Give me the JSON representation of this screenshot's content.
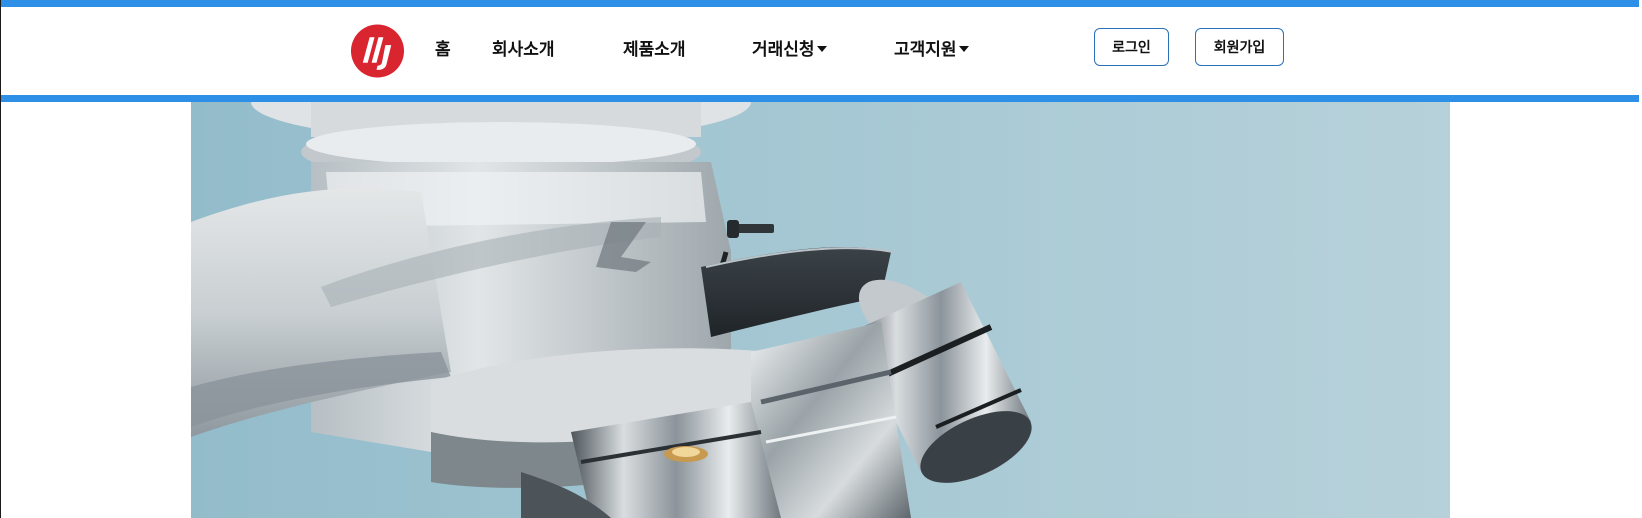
{
  "brand": {
    "logo_icon": "company-logo-icon",
    "logo_color": "#d9252f",
    "accent_color": "#2e8fe6"
  },
  "nav": {
    "items": [
      {
        "label": "홈",
        "has_dropdown": false
      },
      {
        "label": "회사소개",
        "has_dropdown": false
      },
      {
        "label": "제품소개",
        "has_dropdown": false
      },
      {
        "label": "거래신청",
        "has_dropdown": true
      },
      {
        "label": "고객지원",
        "has_dropdown": true
      }
    ]
  },
  "auth": {
    "login_label": "로그인",
    "signup_label": "회원가입"
  },
  "hero": {
    "image_subject": "microscope-photo",
    "background_color": "#a8c9d4"
  }
}
